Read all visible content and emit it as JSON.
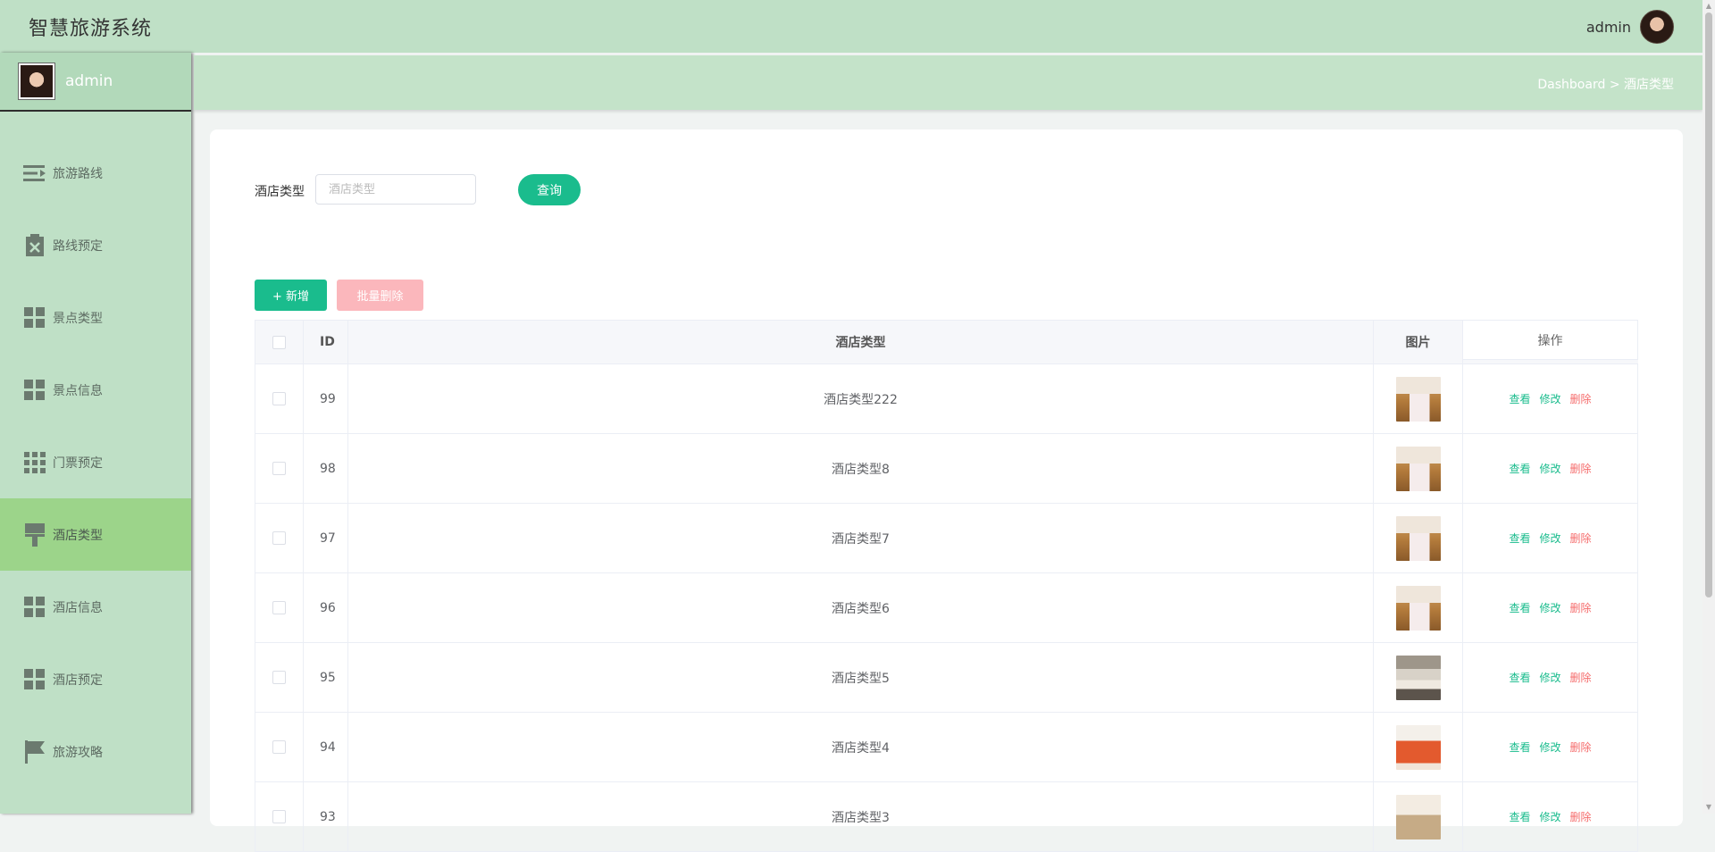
{
  "app": {
    "title": "智慧旅游系统"
  },
  "top_user": {
    "name": "admin"
  },
  "sidebar": {
    "user_name": "admin",
    "items": [
      {
        "label": "旅游路线",
        "icon": "list-indent-icon"
      },
      {
        "label": "路线预定",
        "icon": "clipboard-x-icon"
      },
      {
        "label": "景点类型",
        "icon": "grid-icon"
      },
      {
        "label": "景点信息",
        "icon": "grid-icon"
      },
      {
        "label": "门票预定",
        "icon": "grid-9-icon"
      },
      {
        "label": "酒店类型",
        "icon": "paint-roller-icon",
        "active": true
      },
      {
        "label": "酒店信息",
        "icon": "grid-icon"
      },
      {
        "label": "酒店预定",
        "icon": "grid-icon"
      },
      {
        "label": "旅游攻略",
        "icon": "flag-icon"
      }
    ]
  },
  "breadcrumb": {
    "home": "Dashboard",
    "separator": ">",
    "current": "酒店类型"
  },
  "search": {
    "label": "酒店类型",
    "placeholder": "酒店类型",
    "button": "查询"
  },
  "actions": {
    "add": "+ 新增",
    "batch_delete": "批量删除"
  },
  "table": {
    "headers": {
      "id": "ID",
      "type": "酒店类型",
      "image": "图片",
      "ops": "操作"
    },
    "rows": [
      {
        "id": "99",
        "type": "酒店类型222",
        "thumb": "warm"
      },
      {
        "id": "98",
        "type": "酒店类型8",
        "thumb": "warm"
      },
      {
        "id": "97",
        "type": "酒店类型7",
        "thumb": "warm"
      },
      {
        "id": "96",
        "type": "酒店类型6",
        "thumb": "warm"
      },
      {
        "id": "95",
        "type": "酒店类型5",
        "thumb": "grey"
      },
      {
        "id": "94",
        "type": "酒店类型4",
        "thumb": "orange"
      },
      {
        "id": "93",
        "type": "酒店类型3",
        "thumb": "light"
      }
    ],
    "op_labels": {
      "view": "查看",
      "edit": "修改",
      "delete": "删除"
    }
  },
  "colors": {
    "accent": "#1abc8d",
    "danger": "#f56c6c",
    "sidebar": "#bfe0c6",
    "active": "#9cd48a"
  }
}
